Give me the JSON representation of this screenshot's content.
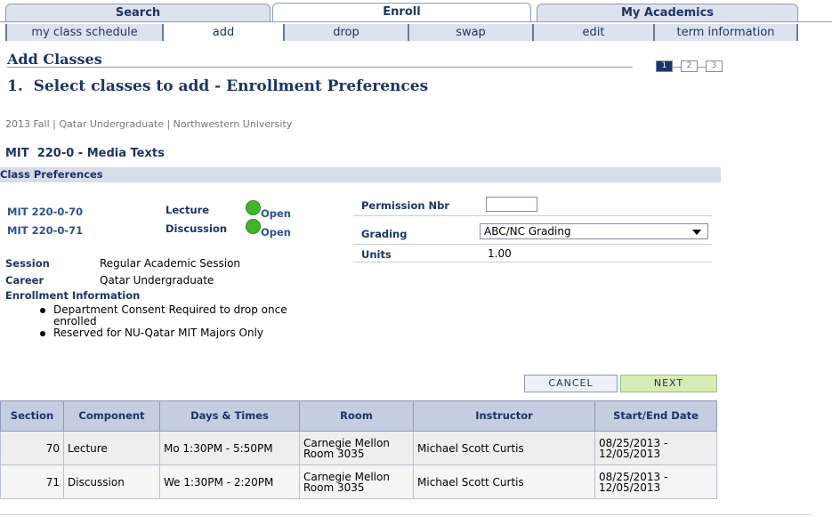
{
  "main_tabs": [
    {
      "label": "Search",
      "active": false
    },
    {
      "label": "Enroll",
      "active": true
    },
    {
      "label": "My Academics",
      "active": false
    }
  ],
  "sub_tabs": [
    {
      "label": "my class schedule"
    },
    {
      "label": "add"
    },
    {
      "label": "drop"
    },
    {
      "label": "swap"
    },
    {
      "label": "edit"
    },
    {
      "label": "term information"
    }
  ],
  "page": {
    "heading": "Add Classes",
    "step_title": "1.  Select classes to add - Enrollment Preferences",
    "steps": [
      "1",
      "2",
      "3"
    ],
    "context": "2013 Fall | Qatar Undergraduate | Northwestern University",
    "course_title": "MIT  220-0 - Media Texts"
  },
  "preferences": {
    "bar_label": "Class Preferences",
    "sections": [
      {
        "code": "MIT 220-0-70",
        "component": "Lecture",
        "status": "Open"
      },
      {
        "code": "MIT 220-0-71",
        "component": "Discussion",
        "status": "Open"
      }
    ],
    "session_label": "Session",
    "session_value": "Regular Academic Session",
    "career_label": "Career",
    "career_value": "Qatar Undergraduate",
    "enroll_info_label": "Enrollment Information",
    "enroll_info_items": [
      "Department Consent Required to drop once enrolled",
      "Reserved for NU-Qatar MIT Majors Only"
    ],
    "permission_label": "Permission Nbr",
    "permission_value": "",
    "grading_label": "Grading",
    "grading_value": "ABC/NC Grading",
    "units_label": "Units",
    "units_value": "1.00"
  },
  "buttons": {
    "cancel": "CANCEL",
    "next": "NEXT"
  },
  "table": {
    "headers": [
      "Section",
      "Component",
      "Days & Times",
      "Room",
      "Instructor",
      "Start/End Date"
    ],
    "rows": [
      {
        "section": "70",
        "component": "Lecture",
        "days": "Mo 1:30PM - 5:50PM",
        "room": "Carnegie Mellon Room 3035",
        "instructor": "Michael Scott Curtis",
        "dates": "08/25/2013 - 12/05/2013"
      },
      {
        "section": "71",
        "component": "Discussion",
        "days": "We 1:30PM - 2:20PM",
        "room": "Carnegie Mellon Room 3035",
        "instructor": "Michael Scott Curtis",
        "dates": "08/25/2013 - 12/05/2013"
      }
    ]
  },
  "colors": {
    "accent": "#1c3466",
    "status_open": "#3fb52a",
    "next_button": "#d6ecb5"
  }
}
